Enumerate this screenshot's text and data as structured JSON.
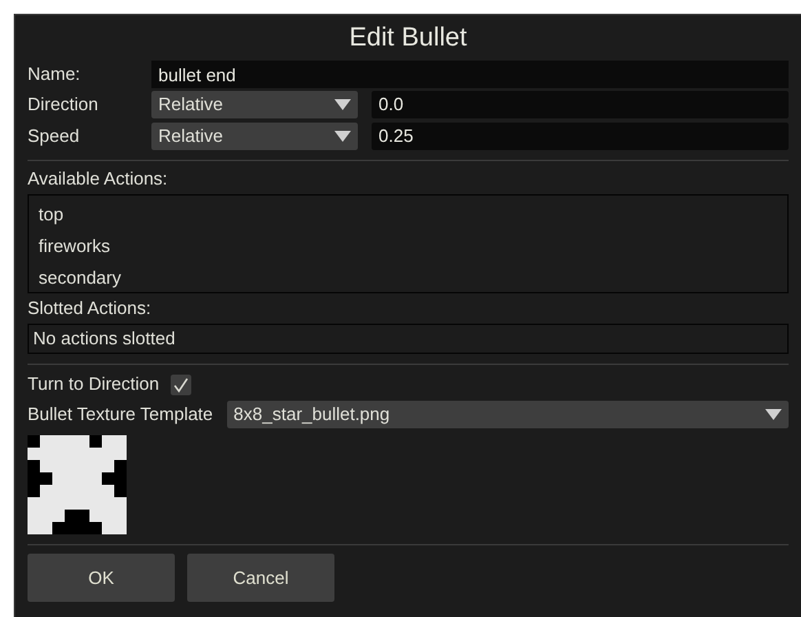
{
  "window": {
    "title": "Edit Bullet"
  },
  "name": {
    "label": "Name:",
    "value": "bullet end"
  },
  "params": [
    {
      "label": "Direction",
      "mode": "Relative",
      "value": "0.0"
    },
    {
      "label": "Speed",
      "mode": "Relative",
      "value": "0.25"
    }
  ],
  "available_actions": {
    "label": "Available Actions:",
    "items": [
      "top",
      "fireworks",
      "secondary"
    ]
  },
  "slotted_actions": {
    "label": "Slotted Actions:",
    "text": "No actions slotted"
  },
  "turn_to_direction": {
    "label": "Turn to Direction",
    "checked": true
  },
  "texture": {
    "label": "Bullet Texture Template",
    "value": "8x8_star_bullet.png"
  },
  "buttons": [
    "OK",
    "Cancel"
  ]
}
